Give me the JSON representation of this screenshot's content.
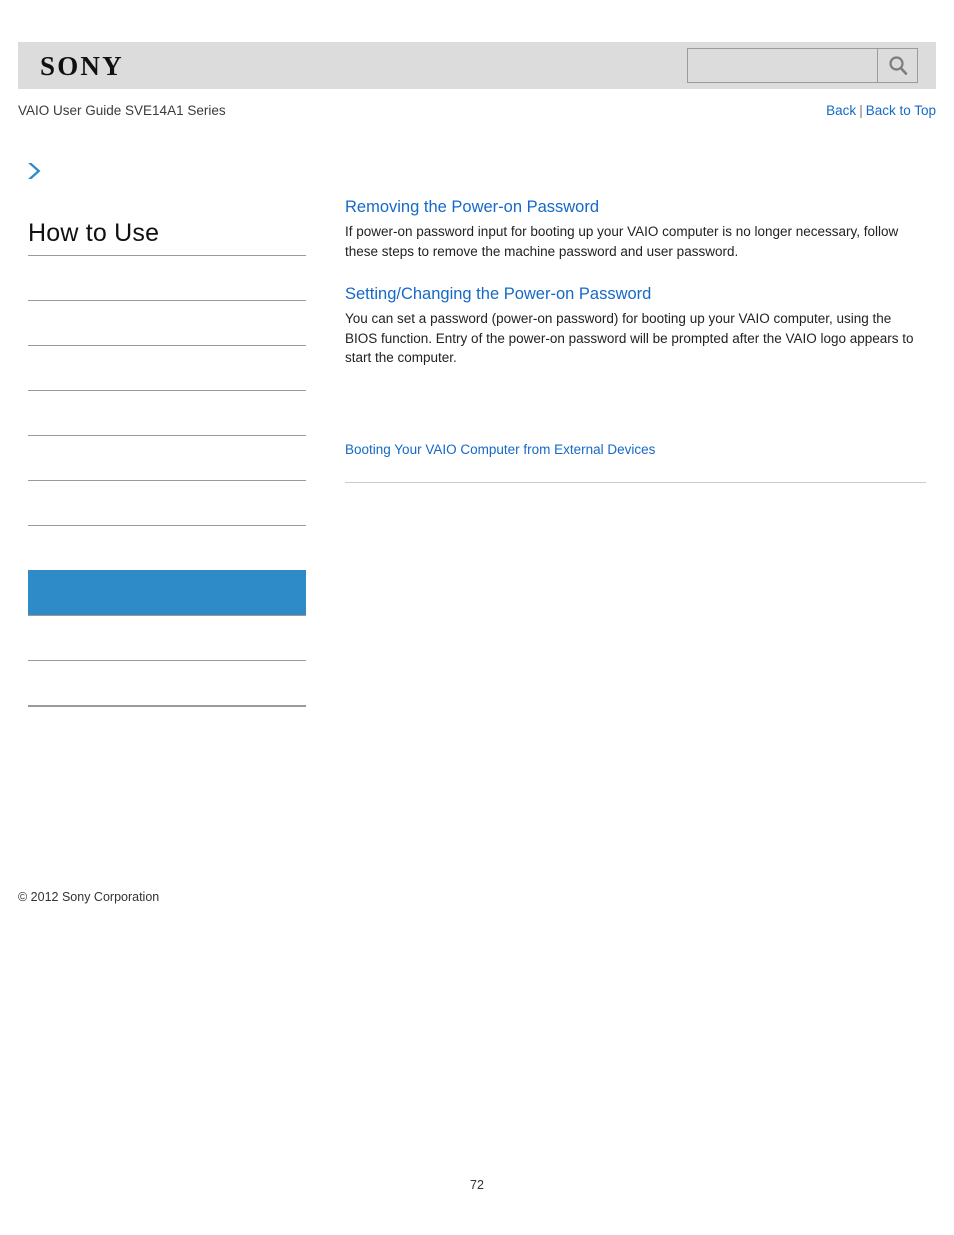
{
  "header": {
    "logo_text": "SONY",
    "search": {
      "value": "",
      "placeholder": "",
      "icon": "search-icon",
      "button_title": "Search"
    }
  },
  "subheader": {
    "guide_title": "VAIO User Guide SVE14A1 Series",
    "back_label": "Back",
    "separator": "|",
    "back_to_top_label": "Back to Top"
  },
  "sidebar": {
    "expand_icon": "chevron-right-icon",
    "title": "How to Use",
    "items": [
      {
        "label": "",
        "selected": false
      },
      {
        "label": "",
        "selected": false
      },
      {
        "label": "",
        "selected": false
      },
      {
        "label": "",
        "selected": false
      },
      {
        "label": "",
        "selected": false
      },
      {
        "label": "",
        "selected": false
      },
      {
        "label": "",
        "selected": false
      },
      {
        "label": "",
        "selected": true
      },
      {
        "label": "",
        "selected": false
      },
      {
        "label": "",
        "selected": false
      }
    ],
    "copyright": "© 2012 Sony Corporation"
  },
  "main": {
    "sections": [
      {
        "title": "Removing the Power-on Password",
        "description": "If power-on password input for booting up your VAIO computer is no longer necessary, follow these steps to remove the machine password and user password."
      },
      {
        "title": "Setting/Changing the Power-on Password",
        "description": "You can set a password (power-on password) for booting up your VAIO computer, using the BIOS function. Entry of the power-on password will be prompted after the VAIO logo appears to start the computer."
      }
    ],
    "related_link": "Booting Your VAIO Computer from External Devices"
  },
  "footer": {
    "page_number": "72"
  },
  "colors": {
    "header_bg": "#dcdcdc",
    "link": "#1569c7",
    "selected_nav": "#2e8bc8",
    "rule": "#9a9a9a"
  }
}
